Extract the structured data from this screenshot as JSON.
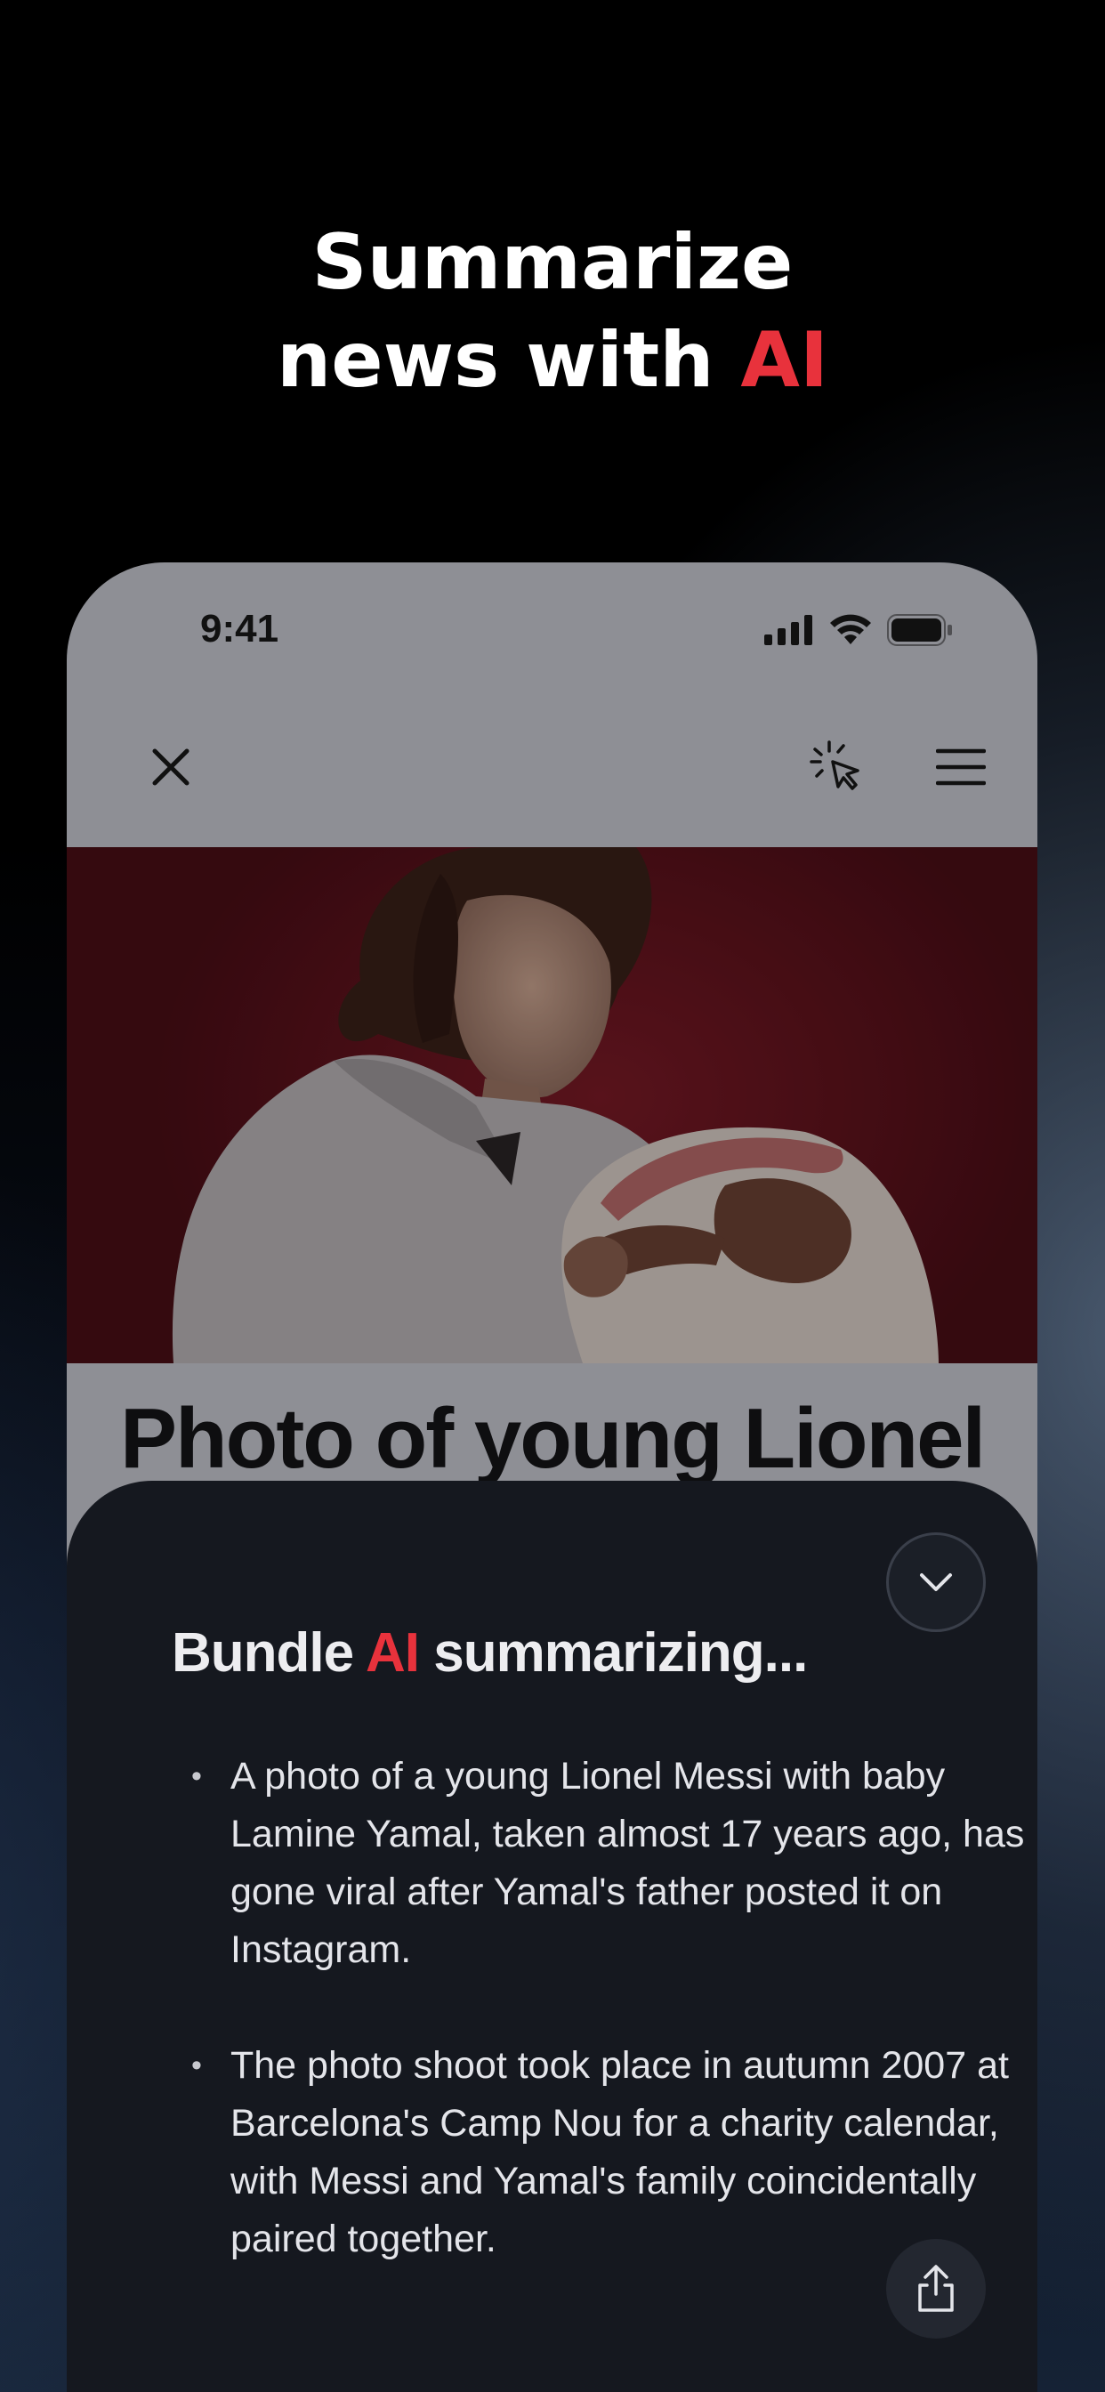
{
  "headline": {
    "line1": "Summarize",
    "line2_prefix": "news with ",
    "line2_accent": "AI"
  },
  "status_bar": {
    "time": "9:41",
    "icons": [
      "cellular-signal-icon",
      "wifi-icon",
      "battery-icon"
    ]
  },
  "toolbar": {
    "icons": [
      "close-icon",
      "click-cursor-icon",
      "menu-icon"
    ]
  },
  "article": {
    "title": "Photo of young Lionel"
  },
  "summary": {
    "title_prefix": "Bundle ",
    "title_accent": "AI",
    "title_suffix": " summarizing...",
    "bullets": [
      "A photo of a young Lionel Messi with baby Lamine Yamal, taken almost 17 years ago, has gone viral after Yamal's father posted it on Instagram.",
      "The photo shoot took place in autumn 2007 at Barcelona's Camp Nou for a charity calendar, with Messi and Yamal's family coincidentally paired together."
    ],
    "icons": [
      "chevron-down-icon",
      "share-icon"
    ]
  },
  "colors": {
    "accent": "#e8323c",
    "sheet_background": "#15181f",
    "phone_overlay": "#8e8f95"
  }
}
